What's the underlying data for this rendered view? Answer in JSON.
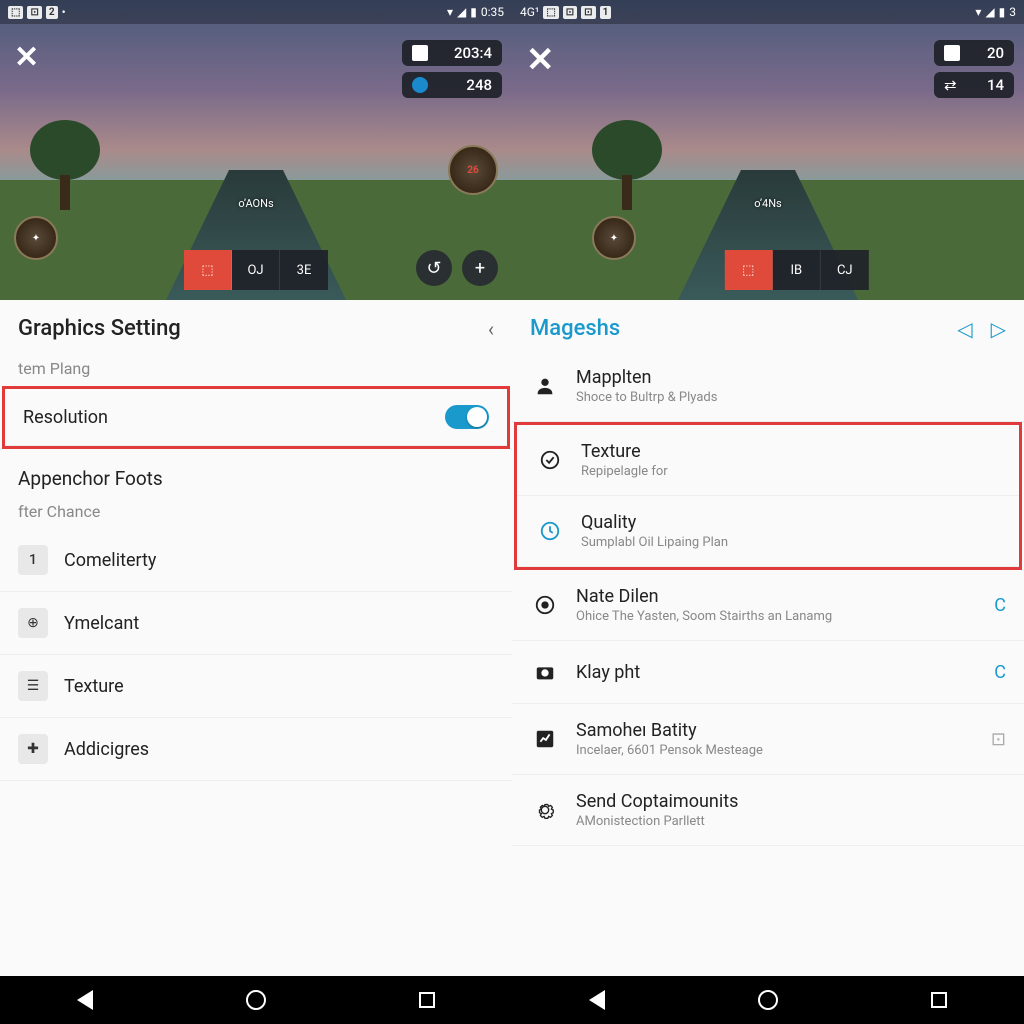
{
  "left": {
    "status": {
      "time": "0:35",
      "badges": [
        "⬚",
        "⊡",
        "2"
      ],
      "dot": "•"
    },
    "game": {
      "hud1_val": "203:4",
      "hud2_val": "248",
      "badge_round_label": "26",
      "center_label": "oʼAONs",
      "bottom": [
        "⬚",
        "OJ",
        "3E"
      ],
      "plus": "+"
    },
    "panel": {
      "title": "Graphics Setting",
      "section1": "tem Plang",
      "resolution": "Resolution",
      "section2": "Appenchor Foots",
      "section3": "fter Chance",
      "rows": [
        {
          "icon": "1",
          "label": "Comeliterty"
        },
        {
          "icon": "⊕",
          "label": "Ymelcant"
        },
        {
          "icon": "☰",
          "label": "Texture"
        },
        {
          "icon": "✚",
          "label": "Addicigres"
        }
      ]
    }
  },
  "right": {
    "status": {
      "left_text": "4G¹",
      "badges": [
        "⬚",
        "⊡",
        "⊡",
        "1"
      ],
      "time": "3"
    },
    "game": {
      "close": "✕",
      "hud1_val": "20",
      "hud2_val": "14",
      "center_label": "oʼ4Ns",
      "bottom": [
        "⬚",
        "IB",
        "CJ"
      ]
    },
    "panel": {
      "title": "Mageshs",
      "rows": [
        {
          "icon": "person",
          "title": "Mapplten",
          "sub": "Shoce to Bultrp & Plyads"
        },
        {
          "icon": "check",
          "title": "Texture",
          "sub": "Repipelagle for"
        },
        {
          "icon": "clock",
          "title": "Quality",
          "sub": "Sumplabl Oil Lipaing Plan"
        },
        {
          "icon": "target",
          "title": "Nate Dilen",
          "sub": "Ohice The Yasten, Soom Stairths an Lanamg",
          "trail": "C"
        },
        {
          "icon": "camera",
          "title": "Klay pht",
          "sub": "",
          "trail": "C"
        },
        {
          "icon": "chart",
          "title": "Samoheı Batity",
          "sub": "Incelaer, 6601 Pensok Mesteage",
          "trail": "⊡"
        },
        {
          "icon": "gear",
          "title": "Send Coptaimounits",
          "sub": "AMonistection Parllett"
        }
      ]
    }
  }
}
